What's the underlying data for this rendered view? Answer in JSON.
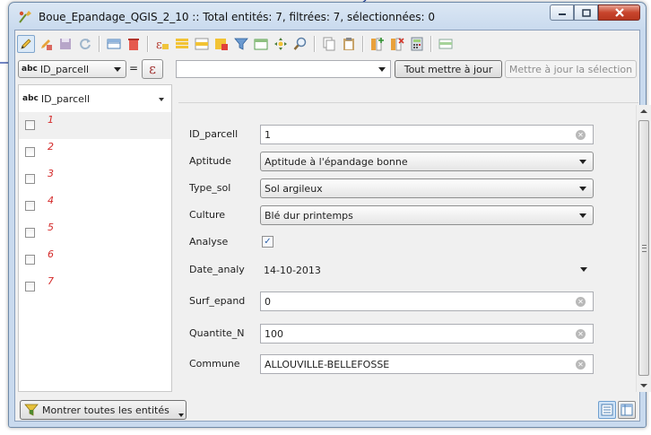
{
  "window": {
    "title": "Boue_Epandage_QGIS_2_10 :: Total entités: 7, filtrées: 7, sélectionnées: 0"
  },
  "toolbar": {
    "icons": [
      "toggle-edit-icon",
      "edit-pencil-icon",
      "save-icon",
      "refresh-icon",
      "add-feature-icon",
      "delete-feature-icon",
      "expression-select-icon",
      "select-all-icon",
      "invert-selection-icon",
      "deselect-icon",
      "filter-selection-icon",
      "move-selection-top-icon",
      "pan-to-selection-icon",
      "zoom-to-selection-icon",
      "copy-icon",
      "paste-icon",
      "new-field-icon",
      "delete-field-icon",
      "field-calculator-icon",
      "conditional-format-icon"
    ]
  },
  "filter_bar": {
    "field_type": "abc",
    "field_name": "ID_parcell",
    "equals": "=",
    "expression_symbol": "ε",
    "value": "",
    "update_all_label": "Tout mettre à jour",
    "update_selection_label": "Mettre à jour la sélection"
  },
  "feature_list": {
    "header_type": "abc",
    "header_field": "ID_parcell",
    "items": [
      "1",
      "2",
      "3",
      "4",
      "5",
      "6",
      "7"
    ]
  },
  "form": {
    "fields": {
      "id_parcell": {
        "label": "ID_parcell",
        "value": "1"
      },
      "aptitude": {
        "label": "Aptitude",
        "value": "Aptitude à l'épandage bonne"
      },
      "type_sol": {
        "label": "Type_sol",
        "value": "Sol argileux"
      },
      "culture": {
        "label": "Culture",
        "value": "Blé dur printemps"
      },
      "analyse": {
        "label": "Analyse",
        "checked": true
      },
      "date_analy": {
        "label": "Date_analy",
        "value": "14-10-2013"
      },
      "surf_epand": {
        "label": "Surf_epand",
        "value": "0"
      },
      "quantite_n": {
        "label": "Quantite_N",
        "value": "100"
      },
      "commune": {
        "label": "Commune",
        "value": "ALLOUVILLE-BELLEFOSSE"
      }
    }
  },
  "footer": {
    "show_all_label": "Montrer toutes les entités"
  },
  "colors": {
    "title_gradient_top": "#dbe7f4",
    "client_bg": "#f0f0f0",
    "list_item_label": "#d42a2a",
    "close_button": "#c8452d",
    "annotation_line": "#1f3fa0"
  }
}
